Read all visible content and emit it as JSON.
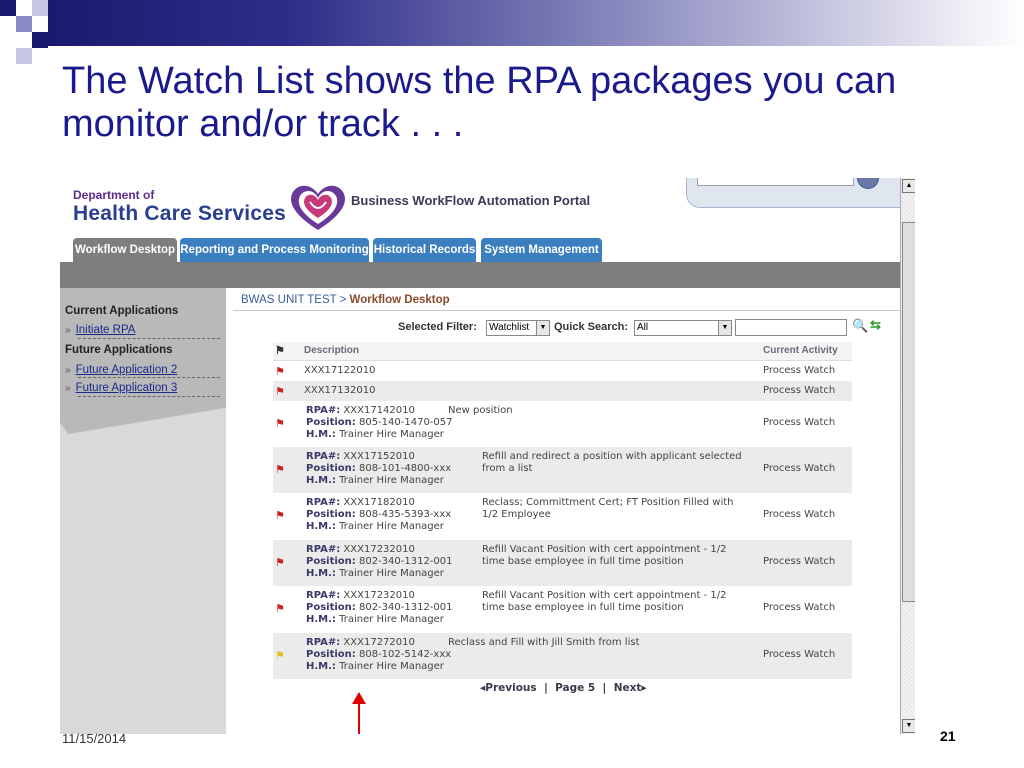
{
  "slide": {
    "title": "The Watch List shows the RPA packages you can monitor and/or track . . .",
    "date": "11/15/2014",
    "page_number": "21"
  },
  "app": {
    "brand_dept": "Department of",
    "brand_name": "Health Care Services",
    "portal_title": "Business WorkFlow Automation Portal",
    "tabs": [
      {
        "label": "Workflow Desktop",
        "active": true
      },
      {
        "label": "Reporting and Process Monitoring",
        "active": false
      },
      {
        "label": "Historical Records",
        "active": false
      },
      {
        "label": "System Management",
        "active": false
      }
    ],
    "sidebar": {
      "current_heading": "Current Applications",
      "current_items": [
        "Initiate RPA"
      ],
      "future_heading": "Future Applications",
      "future_items": [
        "Future Application 2",
        "Future Application 3"
      ]
    },
    "breadcrumb": {
      "root": "BWAS UNIT TEST",
      "separator": " > ",
      "current": "Workflow Desktop"
    },
    "filter": {
      "selected_filter_label": "Selected Filter:",
      "selected_filter_value": "Watchlist",
      "quick_search_label": "Quick Search:",
      "quick_search_value": "All",
      "quick_search_text": ""
    },
    "grid": {
      "columns": [
        "Description",
        "Current Activity"
      ],
      "label_rpa": "RPA#:",
      "label_position": "Position:",
      "label_hm": "H.M.:",
      "rows": [
        {
          "flag": "red",
          "simple": "XXX17122010",
          "activity": "Process Watch"
        },
        {
          "flag": "red",
          "simple": "XXX17132010",
          "activity": "Process Watch"
        },
        {
          "flag": "red",
          "rpa": "XXX17142010",
          "position": "805-140-1470-057",
          "hm": "Trainer Hire Manager",
          "note": "New position",
          "activity": "Process Watch"
        },
        {
          "flag": "red",
          "rpa": "XXX17152010",
          "position": "808-101-4800-xxx",
          "hm": "Trainer Hire Manager",
          "note": "Refill and redirect a position with applicant selected from a list",
          "activity": "Process Watch"
        },
        {
          "flag": "red",
          "rpa": "XXX17182010",
          "position": "808-435-5393-xxx",
          "hm": "Trainer Hire Manager",
          "note": "Reclass; Committment Cert; FT Position Filled with 1/2 Employee",
          "activity": "Process Watch"
        },
        {
          "flag": "red",
          "rpa": "XXX17232010",
          "position": "802-340-1312-001",
          "hm": "Trainer Hire Manager",
          "note": "Refill Vacant Position with cert appointment - 1/2 time base employee in full time position",
          "activity": "Process Watch"
        },
        {
          "flag": "red",
          "rpa": "XXX17232010",
          "position": "802-340-1312-001",
          "hm": "Trainer Hire Manager",
          "note": "Refill Vacant Position with cert appointment - 1/2 time base employee in full time position",
          "activity": "Process Watch"
        },
        {
          "flag": "yellow",
          "rpa": "XXX17272010",
          "position": "808-102-5142-xxx",
          "hm": "Trainer Hire Manager",
          "note": "Reclass and Fill with Jill Smith from list",
          "activity": "Process Watch"
        }
      ]
    },
    "pager": {
      "previous": "Previous",
      "page_label": "Page 5",
      "next": "Next"
    }
  },
  "colors": {
    "title": "#1a1a8c",
    "tab_blue": "#3b7fc0",
    "tab_active": "#7e7e7e",
    "flag_red": "#cc2222",
    "flag_yellow": "#e0c020",
    "arrow": "#e00000"
  }
}
